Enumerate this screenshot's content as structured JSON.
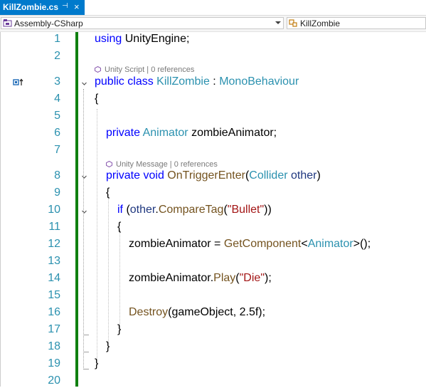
{
  "tab": {
    "filename": "KillZombie.cs",
    "pin_glyph": "⊣",
    "close_glyph": "×"
  },
  "navbar": {
    "project": "Assembly-CSharp",
    "member": "KillZombie",
    "project_icon": "csharp-project-icon",
    "member_icon": "class-icon"
  },
  "colors": {
    "tab_active": "#007acc",
    "change_bar": "#108010",
    "line_number": "#2b91af",
    "keyword": "#0000ff",
    "type": "#2b91af",
    "method": "#74531f",
    "string": "#a31515",
    "parameter": "#1f377f"
  },
  "codelens": {
    "class": "Unity Script | 0 references",
    "method": "Unity Message | 0 references"
  },
  "lines": [
    {
      "num": "1",
      "tokens": [
        [
          "kw",
          "using"
        ],
        [
          "pl",
          " UnityEngine;"
        ]
      ]
    },
    {
      "num": "2",
      "tokens": []
    },
    {
      "num": "3",
      "tokens": [
        [
          "kw",
          "public"
        ],
        [
          "pl",
          " "
        ],
        [
          "kw",
          "class"
        ],
        [
          "pl",
          " "
        ],
        [
          "ty",
          "KillZombie"
        ],
        [
          "pl",
          " : "
        ],
        [
          "ty",
          "MonoBehaviour"
        ]
      ]
    },
    {
      "num": "4",
      "tokens": [
        [
          "pl",
          "{"
        ]
      ]
    },
    {
      "num": "5",
      "tokens": []
    },
    {
      "num": "6",
      "tokens": [
        [
          "kw",
          "private"
        ],
        [
          "pl",
          " "
        ],
        [
          "ty",
          "Animator"
        ],
        [
          "pl",
          " zombieAnimator;"
        ]
      ]
    },
    {
      "num": "7",
      "tokens": []
    },
    {
      "num": "8",
      "tokens": [
        [
          "kw",
          "private"
        ],
        [
          "pl",
          " "
        ],
        [
          "kw",
          "void"
        ],
        [
          "pl",
          " "
        ],
        [
          "mt",
          "OnTriggerEnter"
        ],
        [
          "pl",
          "("
        ],
        [
          "ty",
          "Collider"
        ],
        [
          "pl",
          " "
        ],
        [
          "pm",
          "other"
        ],
        [
          "pl",
          ")"
        ]
      ]
    },
    {
      "num": "9",
      "tokens": [
        [
          "pl",
          "{"
        ]
      ]
    },
    {
      "num": "10",
      "tokens": [
        [
          "kw",
          "if"
        ],
        [
          "pl",
          " ("
        ],
        [
          "pm",
          "other"
        ],
        [
          "pl",
          "."
        ],
        [
          "mt",
          "CompareTag"
        ],
        [
          "pl",
          "("
        ],
        [
          "st",
          "\"Bullet\""
        ],
        [
          "pl",
          "))"
        ]
      ]
    },
    {
      "num": "11",
      "tokens": [
        [
          "pl",
          "{"
        ]
      ]
    },
    {
      "num": "12",
      "tokens": [
        [
          "pl",
          "zombieAnimator = "
        ],
        [
          "mt",
          "GetComponent"
        ],
        [
          "pl",
          "<"
        ],
        [
          "ty",
          "Animator"
        ],
        [
          "pl",
          ">();"
        ]
      ]
    },
    {
      "num": "13",
      "tokens": []
    },
    {
      "num": "14",
      "tokens": [
        [
          "pl",
          "zombieAnimator."
        ],
        [
          "mt",
          "Play"
        ],
        [
          "pl",
          "("
        ],
        [
          "st",
          "\"Die\""
        ],
        [
          "pl",
          ");"
        ]
      ]
    },
    {
      "num": "15",
      "tokens": []
    },
    {
      "num": "16",
      "tokens": [
        [
          "mt",
          "Destroy"
        ],
        [
          "pl",
          "(gameObject, 2.5f);"
        ]
      ]
    },
    {
      "num": "17",
      "tokens": [
        [
          "pl",
          "}"
        ]
      ]
    },
    {
      "num": "18",
      "tokens": [
        [
          "pl",
          "}"
        ]
      ]
    },
    {
      "num": "19",
      "tokens": [
        [
          "pl",
          "}"
        ]
      ]
    },
    {
      "num": "20",
      "tokens": []
    }
  ]
}
